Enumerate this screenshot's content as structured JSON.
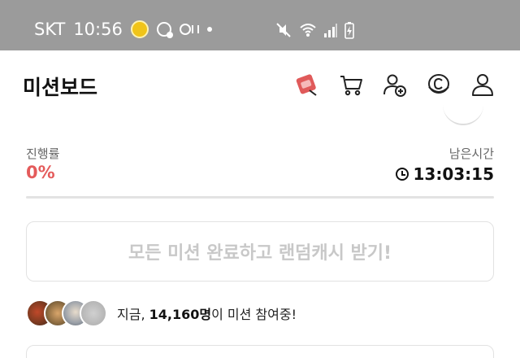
{
  "status_bar": {
    "carrier": "SKT",
    "time": "10:56",
    "icons_left": [
      "sun-weather-icon",
      "data-saver-icon",
      "oc-icon",
      "dot-icon"
    ],
    "icons_right": [
      "mute-icon",
      "wifi-icon",
      "signal-icon",
      "battery-charging-icon"
    ]
  },
  "header": {
    "title": "미션보드",
    "icons": [
      "ticket-icon",
      "cart-icon",
      "add-friend-icon",
      "coin-icon",
      "profile-icon"
    ]
  },
  "progress": {
    "label": "진행률",
    "value": "0%",
    "fill_fraction": 0,
    "remaining_label": "남은시간",
    "remaining_time": "13:03:15"
  },
  "cta": {
    "label": "모든 미션 완료하고 랜덤캐시 받기!"
  },
  "participants": {
    "prefix": "지금, ",
    "count": "14,160명",
    "suffix": "이 미션 참여중!"
  },
  "colors": {
    "accent": "#e45b5b",
    "status_bar": "#9b9b9b",
    "ticket_icon": "#e05a5a"
  }
}
